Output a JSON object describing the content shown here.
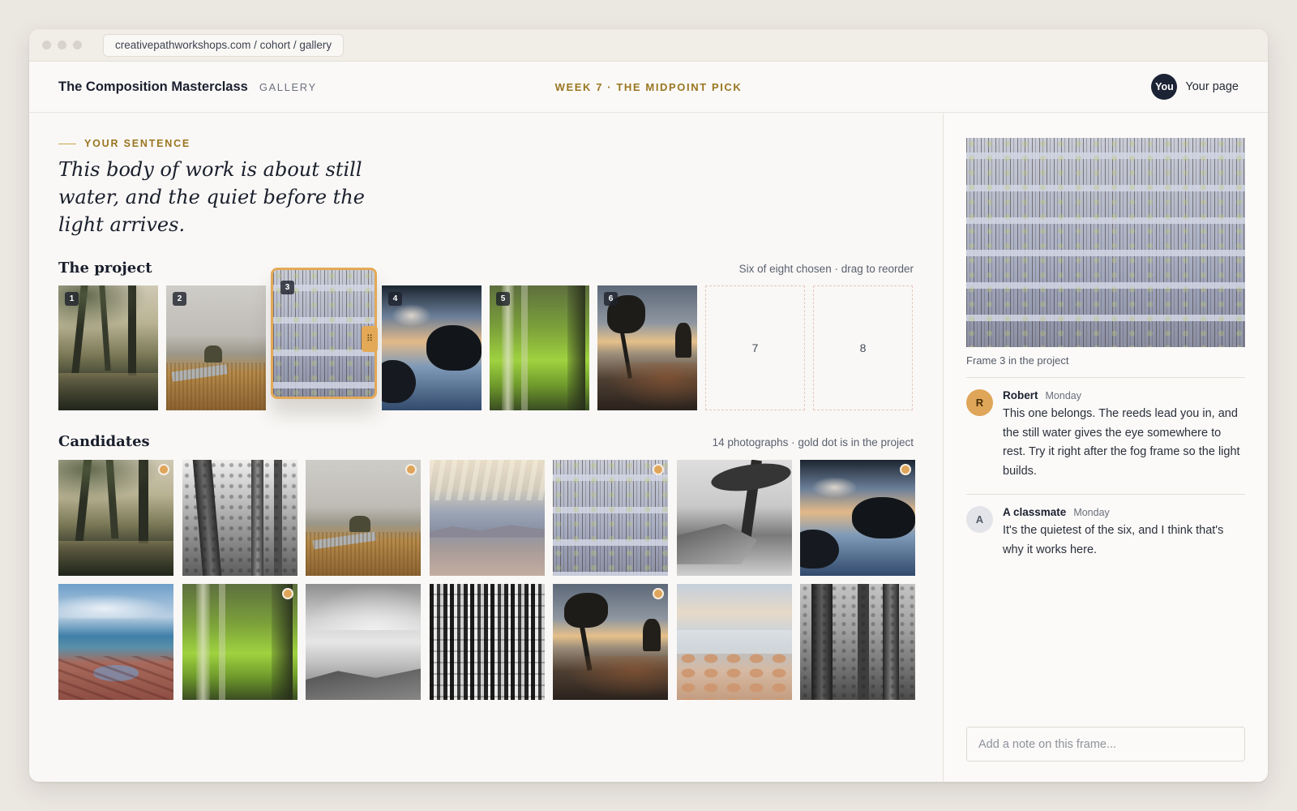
{
  "browser": {
    "url": "creativepathworkshops.com / cohort / gallery"
  },
  "header": {
    "brand": "The Composition Masterclass",
    "section": "GALLERY",
    "week": "WEEK 7 · THE MIDPOINT PICK",
    "avatar": "You",
    "user_link": "Your page"
  },
  "sentence": {
    "label": "YOUR SENTENCE",
    "text": "This body of work is about still water, and the quiet before the light arrives."
  },
  "project": {
    "title": "The project",
    "note": "Six of eight chosen · drag to reorder",
    "slots": [
      {
        "number": "1",
        "image": "misty-forest-pond"
      },
      {
        "number": "2",
        "image": "fog-marsh-stream"
      },
      {
        "number": "3",
        "image": "reeds-still-water",
        "selected": true
      },
      {
        "number": "4",
        "image": "cloud-reflection-rocks"
      },
      {
        "number": "5",
        "image": "green-blur-trees"
      },
      {
        "number": "6",
        "image": "pine-sunset-cliff"
      },
      {
        "number": "7",
        "empty": true
      },
      {
        "number": "8",
        "empty": true
      }
    ]
  },
  "candidates": {
    "title": "Candidates",
    "note": "14 photographs · gold dot is in the project",
    "items": [
      {
        "image": "misty-forest-pond",
        "in_project": true
      },
      {
        "image": "bw-forest-trunks",
        "in_project": false
      },
      {
        "image": "fog-marsh-stream",
        "in_project": true
      },
      {
        "image": "canyon-haze",
        "in_project": false
      },
      {
        "image": "reeds-still-water",
        "in_project": true
      },
      {
        "image": "bw-windswept-tree",
        "in_project": false
      },
      {
        "image": "cloud-reflection-rocks",
        "in_project": true
      },
      {
        "image": "red-rock-shore",
        "in_project": false
      },
      {
        "image": "green-blur-trees",
        "in_project": true
      },
      {
        "image": "bw-long-exposure-sea",
        "in_project": false
      },
      {
        "image": "bw-birch-trunks",
        "in_project": false
      },
      {
        "image": "pine-sunset-cliff",
        "in_project": true
      },
      {
        "image": "pastel-cobble-beach",
        "in_project": false
      },
      {
        "image": "bw-forest-trunks-2",
        "in_project": false
      }
    ]
  },
  "sidebar": {
    "preview_image": "reeds-still-water",
    "caption": "Frame 3 in the project",
    "comments": [
      {
        "initial": "R",
        "name": "Robert",
        "time": "Monday",
        "text": "This one belongs. The reeds lead you in, and the still water gives the eye somewhere to rest. Try it right after the fog frame so the light builds."
      },
      {
        "initial": "A",
        "name": "A classmate",
        "time": "Monday",
        "text": "It's the quietest of the six, and I think that's why it works here."
      }
    ],
    "note_placeholder": "Add a note on this frame..."
  },
  "colors": {
    "accent_gold": "#9a7621",
    "selection_gold": "#e3a957",
    "dark_avatar": "#1c2335"
  }
}
